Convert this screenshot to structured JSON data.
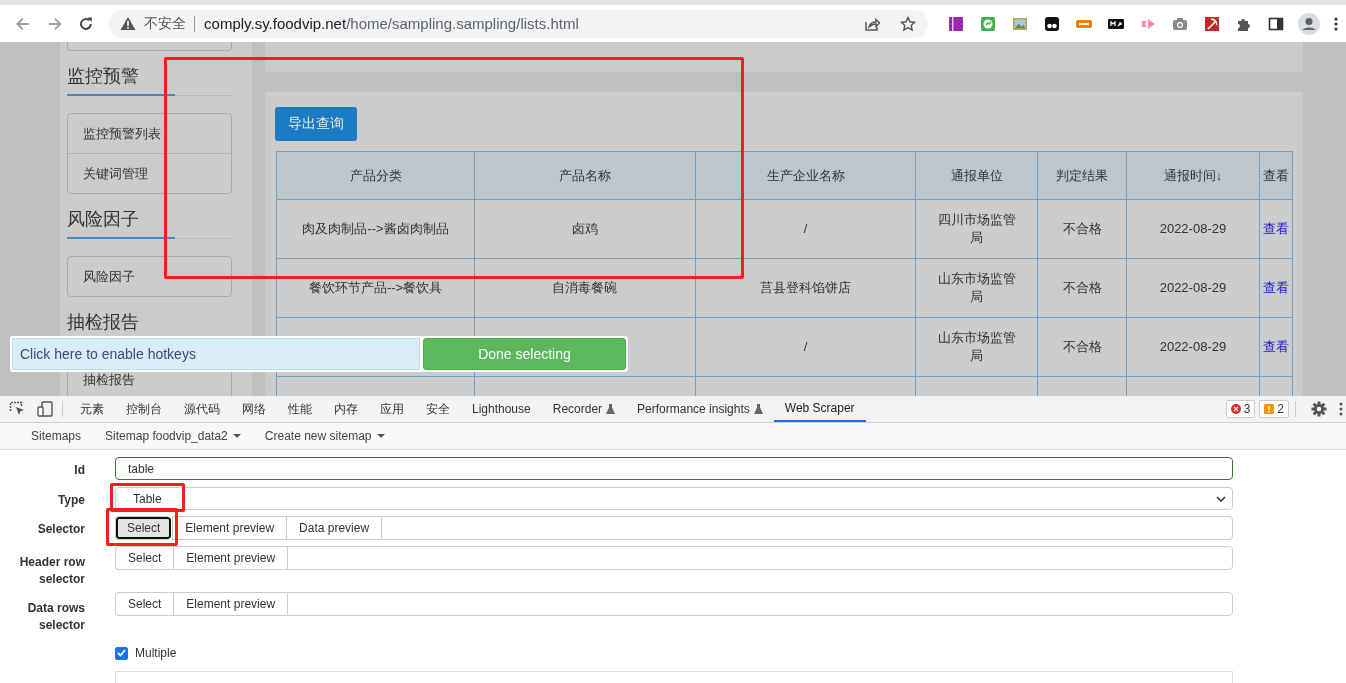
{
  "browser": {
    "security_label": "不安全",
    "url_host": "comply.sy.foodvip.net",
    "url_path": "/home/sampling.sampling/lists.html"
  },
  "sidebar": {
    "sections": [
      {
        "heading": "监控预警",
        "items": [
          "监控预警列表",
          "关键词管理"
        ]
      },
      {
        "heading": "风险因子",
        "items": [
          "风险因子"
        ]
      },
      {
        "heading": "抽检报告",
        "items": [
          "抽检报告"
        ]
      }
    ]
  },
  "export_button": "导出查询",
  "table": {
    "columns": [
      "产品分类",
      "产品名称",
      "生产企业名称",
      "通报单位",
      "判定结果",
      "通报时间↓",
      "查看"
    ],
    "rows": [
      {
        "category": "肉及肉制品-->酱卤肉制品",
        "product": "卤鸡",
        "company": "/",
        "unit": "四川市场监管局",
        "result": "不合格",
        "date": "2022-08-29",
        "link": "查看"
      },
      {
        "category": "餐饮环节产品-->餐饮具",
        "product": "自消毒餐碗",
        "company": "莒县登科馅饼店",
        "unit": "山东市场监管局",
        "result": "不合格",
        "date": "2022-08-29",
        "link": "查看"
      },
      {
        "company": "/",
        "unit": "山东市场监管局",
        "result": "不合格",
        "date": "2022-08-29",
        "link": "查看"
      }
    ]
  },
  "selection_bar": {
    "hotkeys_text": "Click here to enable hotkeys",
    "done_button": "Done selecting"
  },
  "devtools": {
    "tabs": [
      {
        "label": "元素",
        "selected": false,
        "experimental": false
      },
      {
        "label": "控制台",
        "selected": false,
        "experimental": false
      },
      {
        "label": "源代码",
        "selected": false,
        "experimental": false
      },
      {
        "label": "网络",
        "selected": false,
        "experimental": false
      },
      {
        "label": "性能",
        "selected": false,
        "experimental": false
      },
      {
        "label": "内存",
        "selected": false,
        "experimental": false
      },
      {
        "label": "应用",
        "selected": false,
        "experimental": false
      },
      {
        "label": "安全",
        "selected": false,
        "experimental": false
      },
      {
        "label": "Lighthouse",
        "selected": false,
        "experimental": false
      },
      {
        "label": "Recorder",
        "selected": false,
        "experimental": true
      },
      {
        "label": "Performance insights",
        "selected": false,
        "experimental": true
      },
      {
        "label": "Web Scraper",
        "selected": true,
        "experimental": false
      }
    ],
    "error_count": "3",
    "warning_count": "2"
  },
  "scraper_nav": [
    {
      "label": "Sitemaps",
      "dropdown": false
    },
    {
      "label": "Sitemap foodvip_data2",
      "dropdown": true
    },
    {
      "label": "Create new sitemap",
      "dropdown": true
    }
  ],
  "form": {
    "rows": [
      {
        "kind": "text",
        "label": "Id",
        "value": "table"
      },
      {
        "kind": "select",
        "label": "Type",
        "value": "Table"
      },
      {
        "kind": "buttons",
        "label": "Selector",
        "buttons": [
          {
            "label": "Select",
            "pressed": true
          },
          {
            "label": "Element preview",
            "pressed": false
          },
          {
            "label": "Data preview",
            "pressed": false
          }
        ]
      },
      {
        "kind": "buttons",
        "label": "Header row selector",
        "buttons": [
          {
            "label": "Select",
            "pressed": false
          },
          {
            "label": "Element preview",
            "pressed": false
          }
        ]
      },
      {
        "kind": "buttons",
        "label": "Data rows selector",
        "buttons": [
          {
            "label": "Select",
            "pressed": false
          },
          {
            "label": "Element preview",
            "pressed": false
          }
        ]
      },
      {
        "kind": "checkbox",
        "label": "Multiple",
        "checked": true
      }
    ]
  }
}
